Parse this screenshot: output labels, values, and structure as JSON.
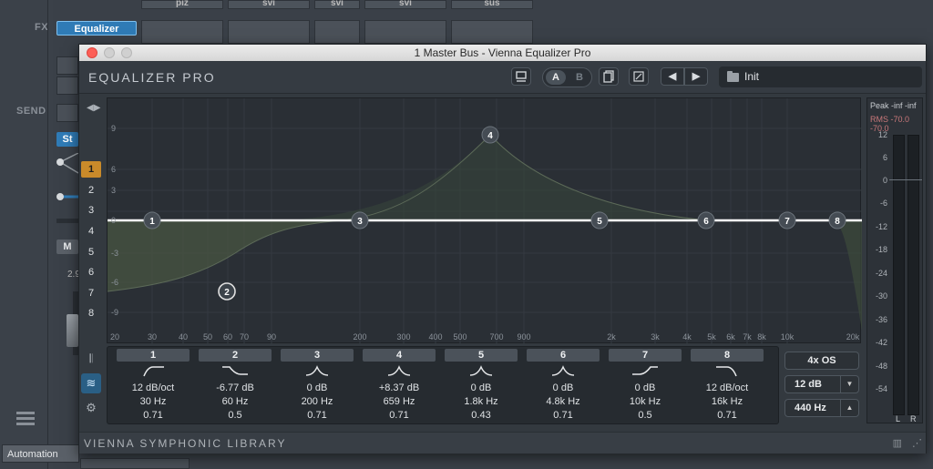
{
  "daw": {
    "fx_label": "FX",
    "send_label": "SEND",
    "equalizer_slot": "Equalizer",
    "st_button": "St",
    "m_button": "M",
    "value_partial": "2.9",
    "top_slots": [
      "piz",
      "svi",
      "svi",
      "svi",
      "sus"
    ],
    "automation_tab": "Automation",
    "colors": {
      "slot_active": "#2f7bb6"
    }
  },
  "window": {
    "title": "1 Master Bus - Vienna Equalizer Pro"
  },
  "plugin": {
    "name": "EQUALIZER PRO",
    "ab": {
      "a": "A",
      "b": "B"
    },
    "preset_name": "Init",
    "footer": "VIENNA SYMPHONIC LIBRARY",
    "icons": [
      "screen-icon",
      "copy-icon",
      "resize-icon",
      "prev-icon",
      "next-icon",
      "folder-icon"
    ]
  },
  "band_selector": [
    "1",
    "2",
    "3",
    "4",
    "5",
    "6",
    "7",
    "8"
  ],
  "graph": {
    "db_labels": [
      "9",
      "6",
      "3",
      "0",
      "-3",
      "-6",
      "-9"
    ],
    "freq_labels": [
      "20",
      "30",
      "40",
      "50",
      "60",
      "70",
      "90",
      "200",
      "300",
      "400",
      "500",
      "700",
      "900",
      "2k",
      "3k",
      "4k",
      "5k",
      "6k",
      "7k",
      "8k",
      "10k",
      "20k"
    ],
    "nodes": [
      "1",
      "2",
      "3",
      "4",
      "5",
      "6",
      "7",
      "8"
    ],
    "colors": {
      "curve": "#ffffff",
      "fill": "#4a5a42"
    }
  },
  "meter": {
    "header": "Peak -inf -inf",
    "rms": "RMS -70.0 -70.0",
    "ticks": [
      "12",
      "6",
      "0",
      "-6",
      "-12",
      "-18",
      "-24",
      "-30",
      "-36",
      "-42",
      "-48",
      "-54"
    ],
    "left": "L",
    "right": "R"
  },
  "bands": [
    {
      "number": "1",
      "shape": "high-pass",
      "gain": "12 dB/oct",
      "freq": "30 Hz",
      "q": "0.71"
    },
    {
      "number": "2",
      "shape": "low-shelf",
      "gain": "-6.77 dB",
      "freq": "60 Hz",
      "q": "0.5"
    },
    {
      "number": "3",
      "shape": "peak",
      "gain": "0 dB",
      "freq": "200 Hz",
      "q": "0.71"
    },
    {
      "number": "4",
      "shape": "peak",
      "gain": "+8.37 dB",
      "freq": "659 Hz",
      "q": "0.71"
    },
    {
      "number": "5",
      "shape": "peak",
      "gain": "0 dB",
      "freq": "1.8k Hz",
      "q": "0.43"
    },
    {
      "number": "6",
      "shape": "peak",
      "gain": "0 dB",
      "freq": "4.8k Hz",
      "q": "0.71"
    },
    {
      "number": "7",
      "shape": "high-shelf",
      "gain": "0 dB",
      "freq": "10k Hz",
      "q": "0.5"
    },
    {
      "number": "8",
      "shape": "low-pass",
      "gain": "12 dB/oct",
      "freq": "16k Hz",
      "q": "0.71"
    }
  ],
  "controls": {
    "oversampling": "4x OS",
    "range": "12 dB",
    "tuning": "440 Hz"
  }
}
